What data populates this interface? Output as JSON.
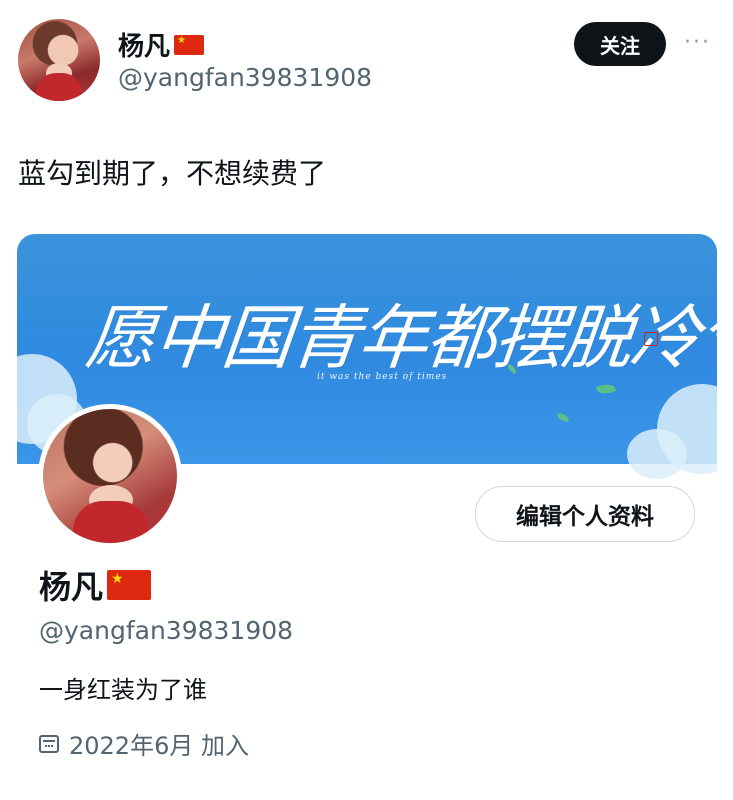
{
  "tweet": {
    "author_name": "杨凡",
    "author_handle": "@yangfan39831908",
    "follow_label": "关注",
    "more_label": "···",
    "text": "蓝勾到期了，不想续费了"
  },
  "profile_card": {
    "banner_title": "愿中国青年都摆脱冷气",
    "banner_subtitle": "it was the best of times",
    "edit_profile_label": "编辑个人资料",
    "name": "杨凡",
    "handle": "@yangfan39831908",
    "bio": "一身红装为了谁",
    "joined": "2022年6月 加入"
  },
  "colors": {
    "text_primary": "#0f1419",
    "text_secondary": "#536471",
    "follow_button": "#0f1419",
    "banner_blue": "#2f8ae0",
    "flag_red": "#de2910"
  },
  "icons": [
    "china-flag-icon",
    "calendar-icon",
    "more-icon"
  ]
}
